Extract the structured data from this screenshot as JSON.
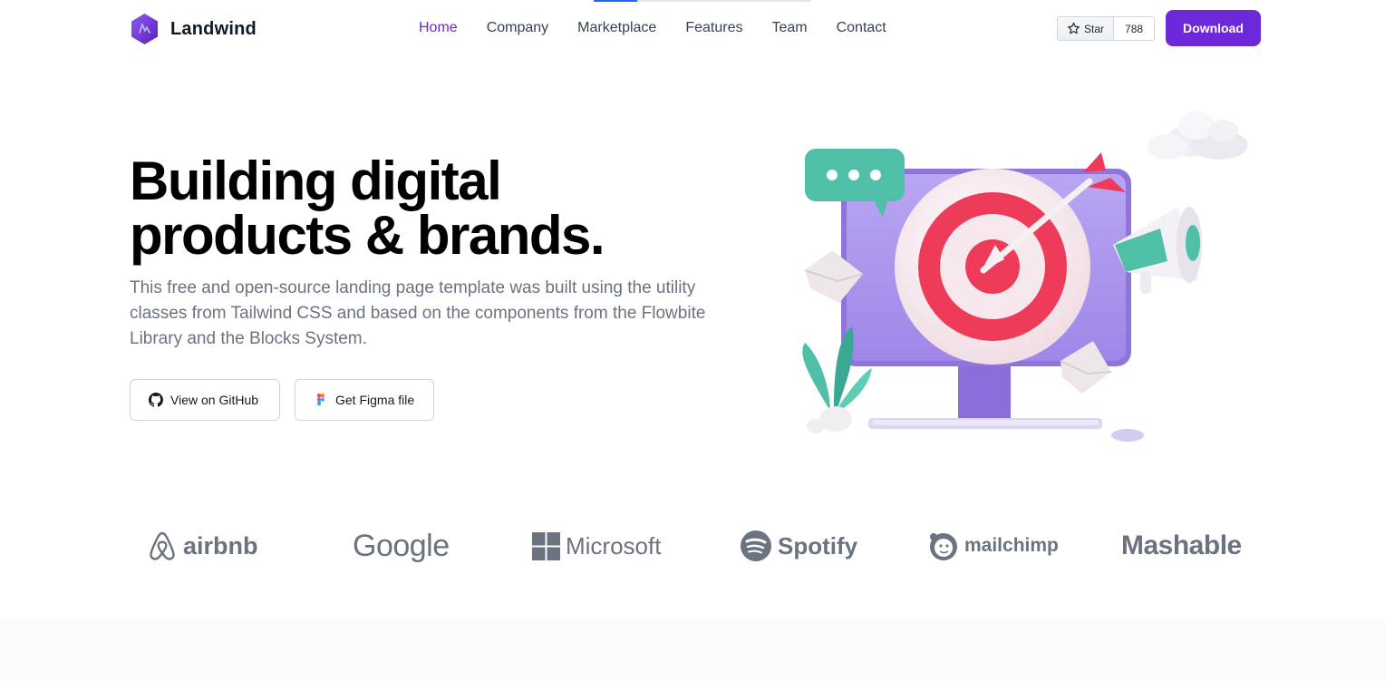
{
  "loading_progress": 0.2,
  "brand": {
    "name": "Landwind",
    "accent": "#6d28d9"
  },
  "nav": {
    "items": [
      {
        "label": "Home",
        "active": true
      },
      {
        "label": "Company",
        "active": false
      },
      {
        "label": "Marketplace",
        "active": false
      },
      {
        "label": "Features",
        "active": false
      },
      {
        "label": "Team",
        "active": false
      },
      {
        "label": "Contact",
        "active": false
      }
    ]
  },
  "github_star": {
    "label": "Star",
    "count": "788",
    "icon": "star-icon"
  },
  "header": {
    "download_label": "Download"
  },
  "hero": {
    "title_line1": "Building digital",
    "title_line2": "products & brands.",
    "description": "This free and open-source landing page template was built using the utility classes from Tailwind CSS and based on the components from the Flowbite Library and the Blocks System.",
    "github_button": {
      "label": "View on GitHub",
      "icon": "github-icon"
    },
    "figma_button": {
      "label": "Get Figma file",
      "icon": "figma-icon"
    }
  },
  "logos": [
    {
      "name": "airbnb",
      "icon": "airbnb-icon"
    },
    {
      "name": "Google",
      "icon": ""
    },
    {
      "name": "Microsoft",
      "icon": "microsoft-icon"
    },
    {
      "name": "Spotify",
      "icon": "spotify-icon"
    },
    {
      "name": "mailchimp",
      "icon": "mailchimp-icon"
    },
    {
      "name": "Mashable",
      "icon": ""
    }
  ],
  "colors": {
    "primary": "#6d28d9",
    "text_muted": "#6b7280",
    "target_red": "#ef3b5a",
    "monitor_purple": "#a78bfa",
    "teal": "#4fbfa8"
  }
}
